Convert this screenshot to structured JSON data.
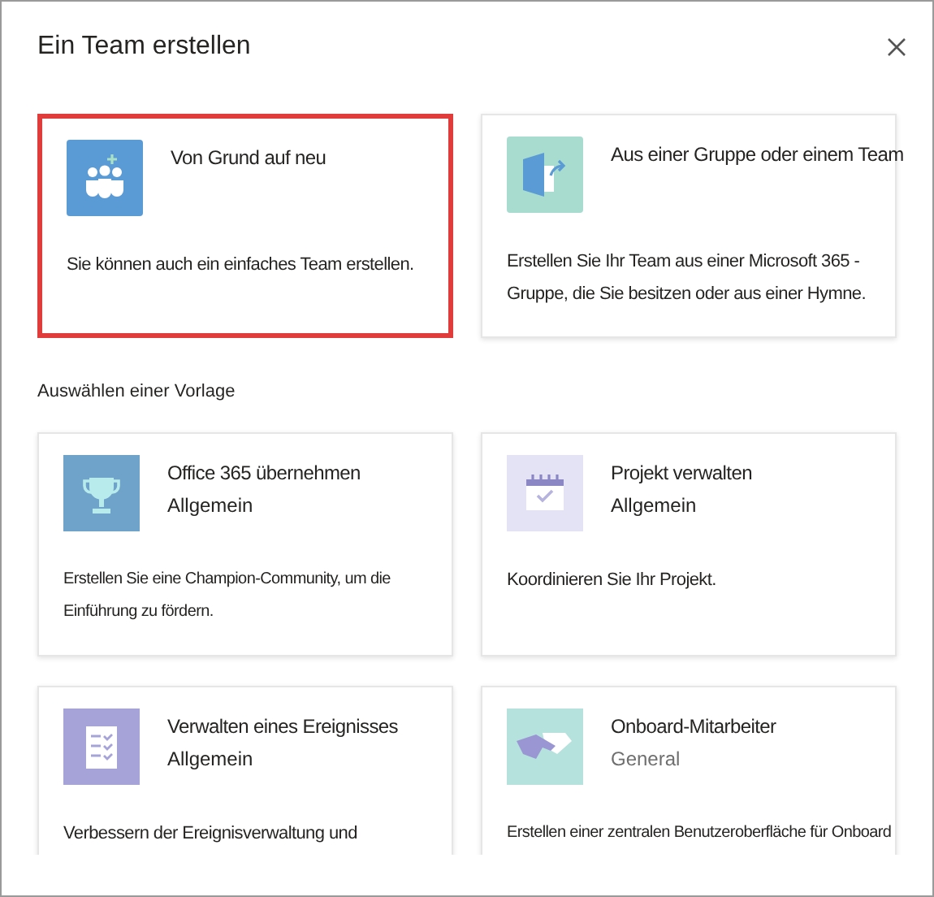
{
  "dialog": {
    "title": "Ein Team erstellen"
  },
  "start_options": [
    {
      "kind": "people",
      "title": "Von Grund auf neu",
      "description": "Sie können auch ein einfaches Team erstellen.",
      "selected": true
    },
    {
      "kind": "group",
      "title": "Aus einer Gruppe oder einem Team",
      "description": "Erstellen Sie Ihr Team aus einer Microsoft 365 -Gruppe, die Sie besitzen oder aus einer Hymne.",
      "selected": false
    }
  ],
  "templates_heading": "Auswählen einer Vorlage",
  "templates": [
    {
      "kind": "trophy",
      "title": "Office 365 übernehmen",
      "subtitle": "Allgemein",
      "muted": false,
      "description": "Erstellen Sie eine Champion-Community, um die Einführung zu fördern."
    },
    {
      "kind": "calendar",
      "title": "Projekt verwalten",
      "subtitle": "Allgemein",
      "muted": false,
      "description": "Koordinieren Sie Ihr Projekt."
    },
    {
      "kind": "checklist",
      "title": "Verwalten eines Ereignisses",
      "subtitle": "Allgemein",
      "muted": false,
      "description": "Verbessern der Ereignisverwaltung und"
    },
    {
      "kind": "handshake",
      "title": "Onboard-Mitarbeiter",
      "subtitle": "General",
      "muted": true,
      "description": "Erstellen einer zentralen Benutzeroberfläche für Onboard"
    }
  ]
}
